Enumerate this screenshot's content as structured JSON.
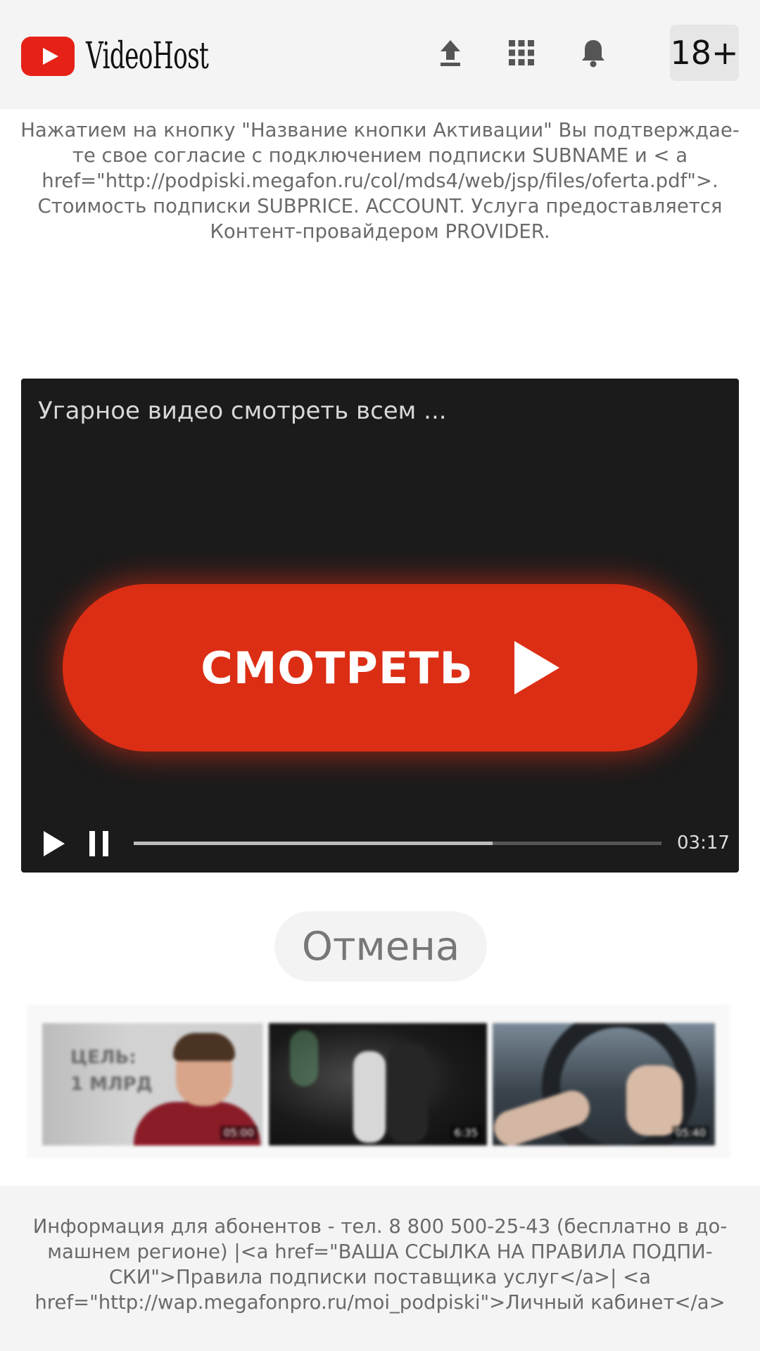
{
  "header": {
    "logo_text": "VideoHost",
    "icons": [
      "upload-icon",
      "apps-grid-icon",
      "bell-icon"
    ],
    "age_badge": "18+"
  },
  "disclaimer": "Нажатием на кнопку \"Название кнопки Активации\" Вы подтверждае-те свое согласие с подключением подписки SUBNAME и < a href=\"http://podpiski.megafon.ru/col/mds4/web/jsp/files/oferta.pdf\">. Стоимость подписки SUBPRICE. ACCOUNT. Услуга предоставляется Контент-провайдером PROVIDER.",
  "player": {
    "title": "Угарное видео смотреть всем ...",
    "watch_label": "СМОТРЕТЬ",
    "time": "03:17",
    "progress": 0.68
  },
  "cancel_label": "Отмена",
  "thumbnails": [
    {
      "overlay_text": "ЦЕЛЬ:\n1 МЛРД",
      "duration": "05:00"
    },
    {
      "duration": "6:35"
    },
    {
      "duration": "05:40"
    }
  ],
  "footer_text": "Информация для абонентов - тел. 8 800 500-25-43 (бесплатно в до-машнем регионе) |<a href=\"ВАША ССЫЛКА НА ПРАВИЛА ПОДПИ-СКИ\">Правила подписки поставщика услуг</a>| <a href=\"http://wap.megafonpro.ru/moi_podpiski\">Личный кабинет</a>",
  "colors": {
    "brand_red": "#e62117",
    "watch_button": "#dc2e14",
    "player_bg": "#1b1b1b",
    "header_bg": "#f4f4f4"
  }
}
